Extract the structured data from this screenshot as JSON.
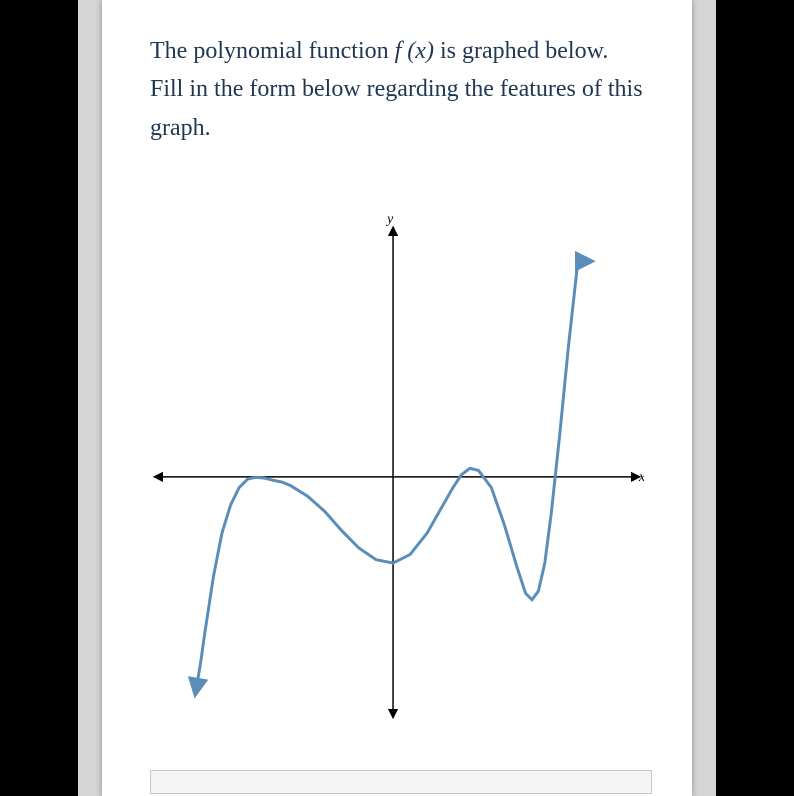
{
  "prompt": {
    "part1": "The polynomial function ",
    "fn": "f (x)",
    "part2": " is graphed below. Fill in the form below regarding the features of this graph."
  },
  "chart_data": {
    "type": "line",
    "title": "",
    "xlabel": "x",
    "ylabel": "y",
    "xlim": [
      -5.5,
      5.5
    ],
    "ylim": [
      -5.5,
      5.5
    ],
    "series": [
      {
        "name": "f(x)",
        "color": "#5a8db8",
        "x": [
          -4.6,
          -4.5,
          -4.4,
          -4.2,
          -4.0,
          -3.8,
          -3.6,
          -3.4,
          -3.2,
          -3.0,
          -2.8,
          -2.6,
          -2.4,
          -2.0,
          -1.6,
          -1.2,
          -0.8,
          -0.4,
          0.0,
          0.4,
          0.8,
          1.2,
          1.4,
          1.6,
          1.8,
          2.0,
          2.3,
          2.6,
          2.9,
          3.1,
          3.25,
          3.4,
          3.55,
          3.7,
          3.9,
          4.1,
          4.3,
          4.4,
          4.5
        ],
        "y": [
          -4.9,
          -4.3,
          -3.6,
          -2.3,
          -1.3,
          -0.65,
          -0.25,
          -0.05,
          -0.01,
          -0.03,
          -0.08,
          -0.12,
          -0.2,
          -0.45,
          -0.8,
          -1.25,
          -1.65,
          -1.92,
          -2.0,
          -1.8,
          -1.3,
          -0.6,
          -0.25,
          0.05,
          0.2,
          0.15,
          -0.25,
          -1.1,
          -2.1,
          -2.7,
          -2.85,
          -2.65,
          -2.0,
          -0.85,
          1.0,
          3.0,
          4.8,
          5.0,
          5.0
        ]
      }
    ],
    "legend": false,
    "grid": false,
    "axes_arrows": true
  }
}
